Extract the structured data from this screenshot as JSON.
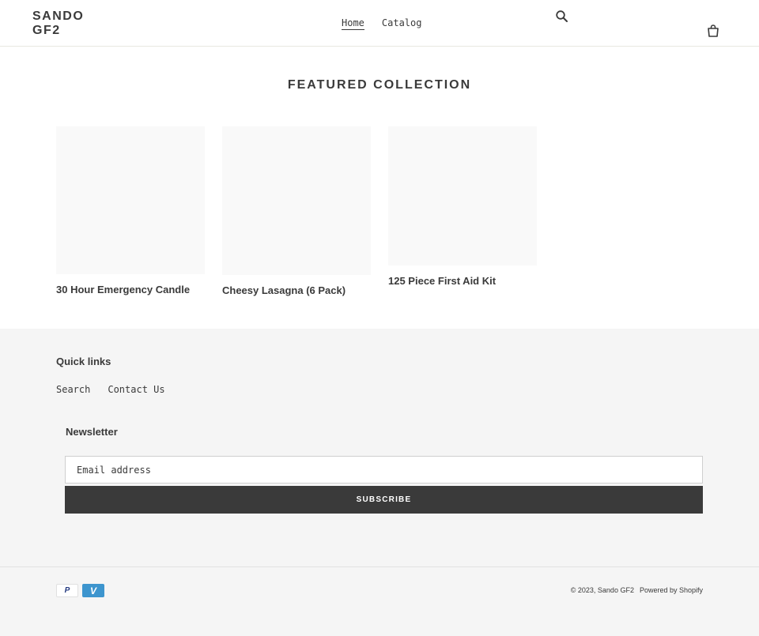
{
  "header": {
    "logo": "SANDO GF2",
    "nav": [
      "Home",
      "Catalog"
    ]
  },
  "featured": {
    "title": "FEATURED COLLECTION",
    "products": [
      {
        "title": "30 Hour Emergency Candle"
      },
      {
        "title": "Cheesy Lasagna (6 Pack)"
      },
      {
        "title": "125 Piece First Aid Kit"
      }
    ]
  },
  "footer": {
    "quick_links_title": "Quick links",
    "quick_links": [
      "Search",
      "Contact Us"
    ],
    "newsletter_title": "Newsletter",
    "email_placeholder": "Email address",
    "subscribe_label": "SUBSCRIBE",
    "payment_icons": [
      "paypal-icon",
      "venmo-icon"
    ],
    "copyright": "© 2023, Sando GF2",
    "powered_by": "Powered by Shopify"
  },
  "colors": {
    "text": "#3a3a3a",
    "footer_bg": "#f5f5f5",
    "button_bg": "#3a3a3a",
    "venmo": "#3d95ce"
  }
}
